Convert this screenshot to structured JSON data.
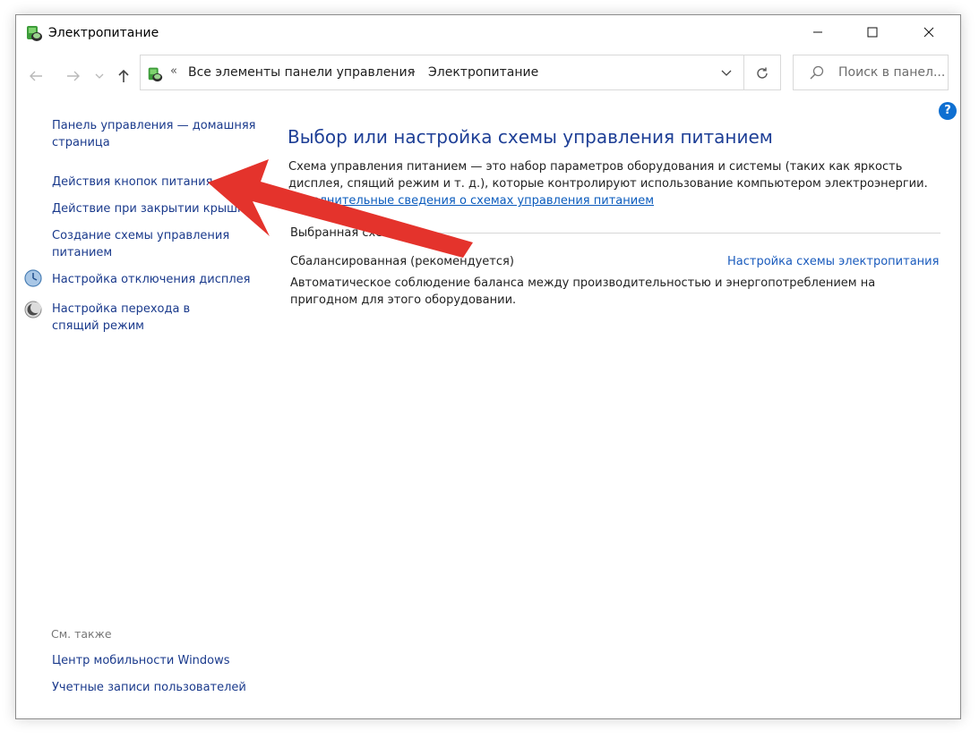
{
  "window": {
    "title": "Электропитание"
  },
  "address": {
    "breadcrumb_parent": "Все элементы панели управления",
    "breadcrumb_current": "Электропитание",
    "chevron_prefix": "«",
    "separator": "›"
  },
  "search": {
    "placeholder": "Поиск в панел..."
  },
  "help": {
    "label": "?"
  },
  "sidebar": {
    "home_link": "Панель управления — домашняя страница",
    "links": [
      "Действия кнопок питания",
      "Действие при закрытии крышки",
      "Создание схемы управления питанием",
      "Настройка отключения дисплея",
      "Настройка перехода в спящий режим"
    ],
    "see_also_title": "См. также",
    "see_also": [
      "Центр мобильности Windows",
      "Учетные записи пользователей"
    ]
  },
  "main": {
    "title": "Выбор или настройка схемы управления питанием",
    "description": "Схема управления питанием — это набор параметров оборудования и системы (таких как яркость дисплея, спящий режим и т. д.), которые контролируют использование компьютером электроэнергии.",
    "more_link": "Дополнительные сведения о схемах управления питанием",
    "selected_plan_label": "Выбранная схема",
    "plan_name": "Сбалансированная (рекомендуется)",
    "plan_config_link": "Настройка схемы электропитания",
    "plan_description": "Автоматическое соблюдение баланса между производительностью и энергопотреблением на пригодном для этого оборудовании."
  },
  "colors": {
    "link": "#1a3a8c",
    "title_blue": "#1e3f96",
    "annotation_arrow": "#e4332c"
  }
}
